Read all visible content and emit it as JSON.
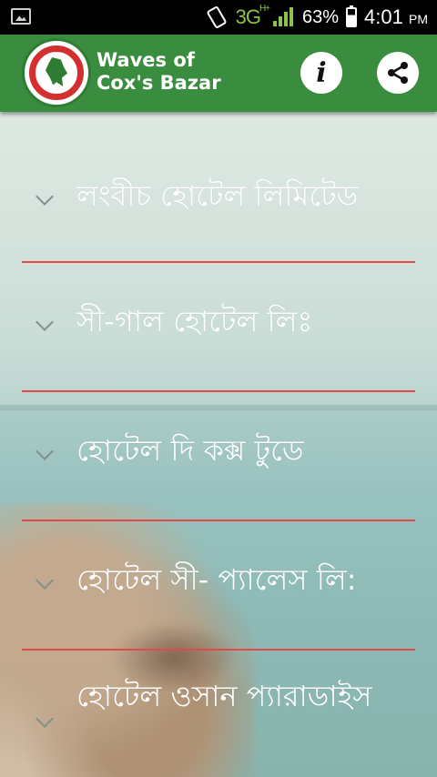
{
  "status_bar": {
    "network": "3G",
    "network_sup": "H+",
    "battery": "63%",
    "battery_level": 0.63,
    "time": "4:01",
    "ampm": "PM"
  },
  "app_bar": {
    "title_line1": "Waves of",
    "title_line2": "Cox's Bazar",
    "info_icon": "info-icon",
    "share_icon": "share-icon",
    "bar_color": "#3a8c3f"
  },
  "hotels": [
    {
      "name": "লংবীচ হোটেল লিমিটেড"
    },
    {
      "name": "সী-গাল হোটেল লিঃ"
    },
    {
      "name": "হোটেল দি কক্স টুডে"
    },
    {
      "name": "হোটেল সী- প্যালেস লি:"
    },
    {
      "name": "হোটেল ওসান প্যারাডাইস"
    }
  ],
  "divider_color": "#e24a4a"
}
